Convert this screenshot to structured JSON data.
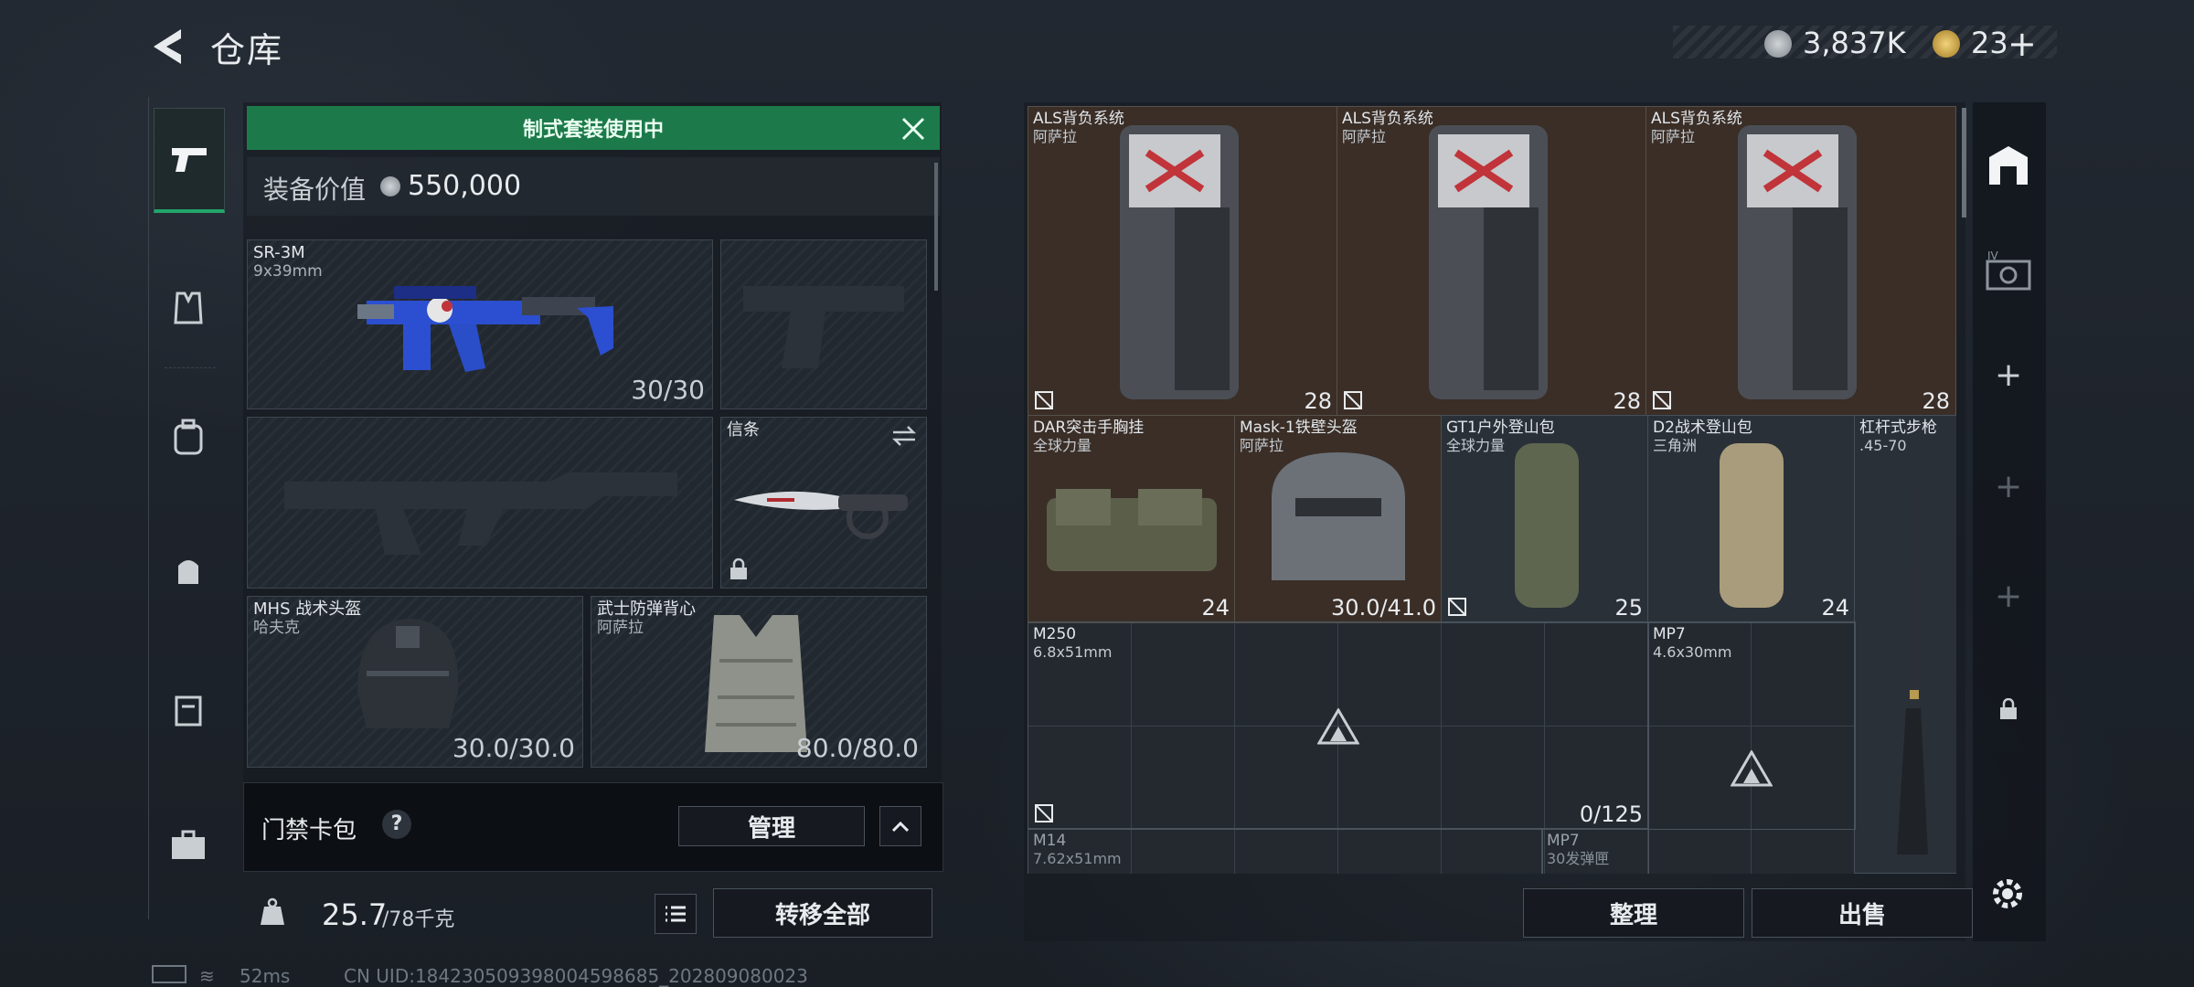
{
  "header": {
    "title": "仓库",
    "currency_silver": "3,837K",
    "currency_gold": "23"
  },
  "loadout": {
    "banner": "制式套装使用中",
    "value_label": "装备价值",
    "value": "550,000",
    "primary": {
      "name": "SR-3M",
      "caliber": "9x39mm",
      "ammo": "30/30"
    },
    "melee": {
      "name": "信条"
    },
    "helmet": {
      "name": "MHS 战术头盔",
      "brand": "哈夫克",
      "durability": "30.0/30.0"
    },
    "armor": {
      "name": "武士防弹背心",
      "brand": "阿萨拉",
      "durability": "80.0/80.0"
    },
    "keycard": {
      "label": "门禁卡包",
      "help": "?",
      "manage": "管理"
    },
    "weight": {
      "current": "25.7",
      "max": "/78千克"
    },
    "transfer_all": "转移全部"
  },
  "inventory": {
    "items": [
      {
        "name": "ALS背负系统",
        "sub": "阿萨拉",
        "count": "28"
      },
      {
        "name": "ALS背负系统",
        "sub": "阿萨拉",
        "count": "28"
      },
      {
        "name": "ALS背负系统",
        "sub": "阿萨拉",
        "count": "28"
      },
      {
        "name": "DAR突击手胸挂",
        "sub": "全球力量",
        "count": "24"
      },
      {
        "name": "Mask-1铁壁头盔",
        "sub": "阿萨拉",
        "count": "30.0/41.0"
      },
      {
        "name": "GT1户外登山包",
        "sub": "全球力量",
        "count": "25"
      },
      {
        "name": "D2战术登山包",
        "sub": "三角洲",
        "count": "24"
      },
      {
        "name": "杠杆式步枪",
        "sub": ".45-70",
        "count": ""
      },
      {
        "name": "M250",
        "sub": "6.8x51mm",
        "count": "0/125"
      },
      {
        "name": "MP7",
        "sub": "4.6x30mm",
        "count": ""
      },
      {
        "name": "M14",
        "sub": "7.62x51mm",
        "count": ""
      },
      {
        "name": "MP7",
        "sub": "30发弹匣",
        "count": ""
      }
    ],
    "sort_label": "整理",
    "sell_label": "出售"
  },
  "status": {
    "ping": "52ms",
    "uid": "CN UID:18423050939800459868​5_202809080023"
  },
  "colors": {
    "accent_green": "#1c7a4a",
    "item_brown": "#3a2e27"
  }
}
